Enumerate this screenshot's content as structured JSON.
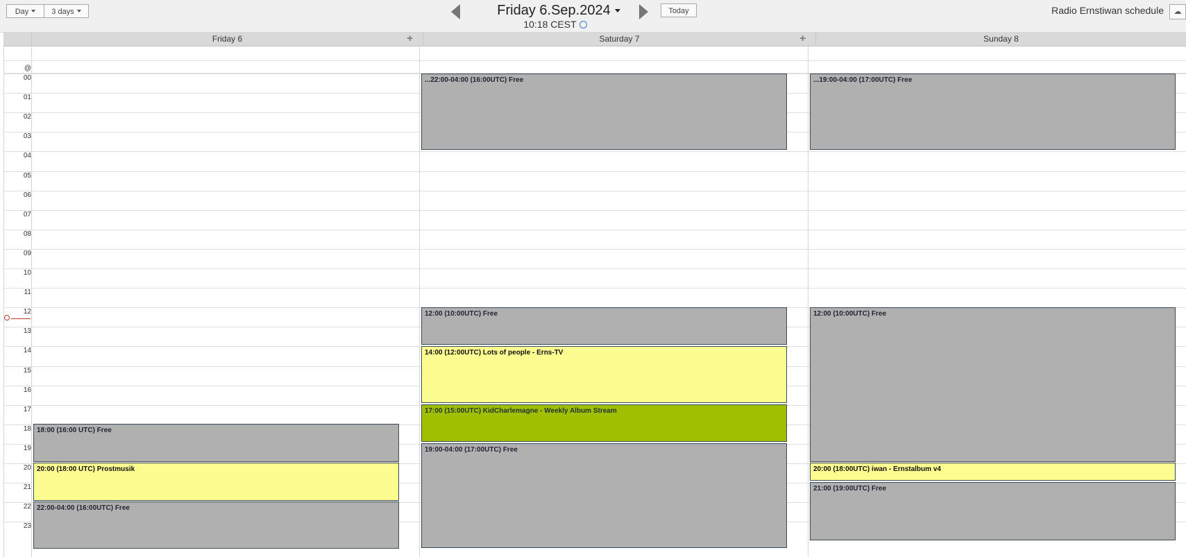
{
  "toolbar": {
    "view_day": "Day",
    "view_3days": "3 days",
    "date_title": "Friday 6.Sep.2024",
    "time_label": "10:18 CEST",
    "today_label": "Today",
    "schedule_title": "Radio Ernstiwan schedule"
  },
  "days": [
    {
      "label": "Friday 6"
    },
    {
      "label": "Saturday 7"
    },
    {
      "label": "Sunday 8"
    }
  ],
  "allday_marker": "@",
  "hours": [
    "00",
    "01",
    "02",
    "03",
    "04",
    "05",
    "06",
    "07",
    "08",
    "09",
    "10",
    "11",
    "12",
    "13",
    "14",
    "15",
    "16",
    "17",
    "18",
    "19",
    "20",
    "21",
    "22",
    "23"
  ],
  "events": {
    "fri": [
      {
        "text": "18:00 (16:00 UTC) Free"
      },
      {
        "text": "20:00 (18:00 UTC) Prostmusik"
      },
      {
        "text": "22:00-04:00 (16:00UTC) Free"
      }
    ],
    "sat": [
      {
        "text": "...22:00-04:00 (16:00UTC) Free"
      },
      {
        "text": "12:00 (10:00UTC) Free"
      },
      {
        "text": "14:00 (12:00UTC) Lots of people - Erns-TV"
      },
      {
        "text": "17:00 (15:00UTC) KidCharlemagne - Weekly Album Stream"
      },
      {
        "text": "19:00-04:00 (17:00UTC) Free"
      }
    ],
    "sun": [
      {
        "text": "...19:00-04:00 (17:00UTC) Free"
      },
      {
        "text": "12:00 (10:00UTC) Free"
      },
      {
        "text": "20:00 (18:00UTC) iwan - Ernstalbum v4"
      },
      {
        "text": "21:00 (19:00UTC) Free"
      }
    ]
  },
  "colors": {
    "free": "#b0b0b0",
    "show": "#fcfc91",
    "live": "#a0bf00",
    "now_indicator": "#c0392b"
  }
}
